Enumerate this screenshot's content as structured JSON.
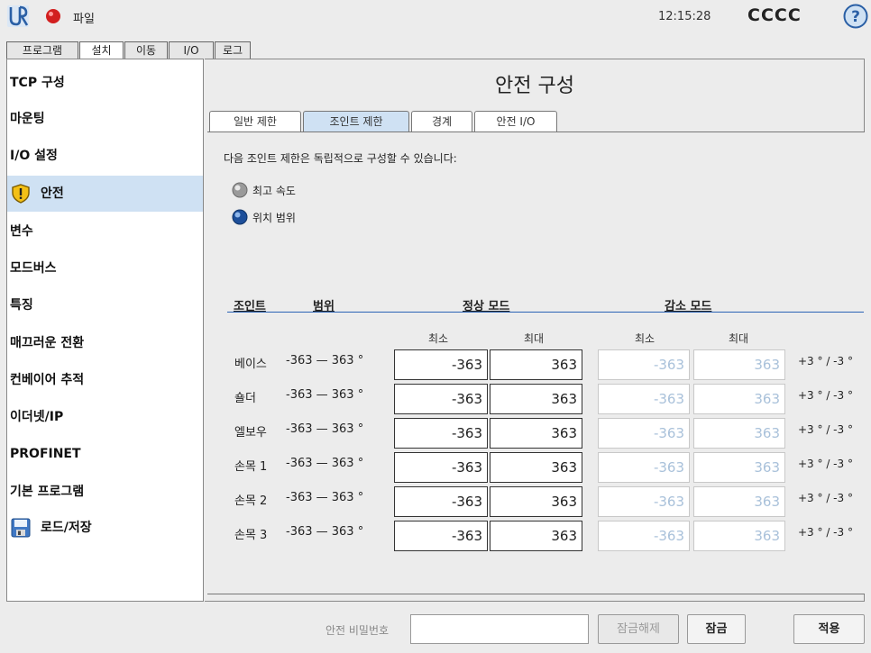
{
  "topbar": {
    "file_menu": "파일",
    "clock": "12:15:28",
    "robot_name": "CCCC"
  },
  "main_tabs": [
    "프로그램",
    "설치",
    "이동",
    "I/O",
    "로그"
  ],
  "sidebar": {
    "items": [
      "TCP 구성",
      "마운팅",
      "I/O 설정",
      "안전",
      "변수",
      "모드버스",
      "특징",
      "매끄러운 전환",
      "컨베이어 추적",
      "이더넷/IP",
      "PROFINET",
      "기본 프로그램",
      "로드/저장"
    ]
  },
  "panel": {
    "title": "안전 구성",
    "sub_tabs": [
      "일반 제한",
      "조인트 제한",
      "경계",
      "안전 I/O"
    ],
    "description": "다음 조인트 제한은 독립적으로 구성할 수 있습니다:",
    "radios": [
      "최고 속도",
      "위치 범위"
    ],
    "headers": {
      "joint": "조인트",
      "range": "범위",
      "normal_mode": "정상 모드",
      "reduced_mode": "감소 모드",
      "min": "최소",
      "max": "최대"
    },
    "rows": [
      {
        "name": "베이스",
        "range": "-363 — 363 °",
        "normal_min": "-363",
        "normal_max": "363",
        "reduced_min": "-363",
        "reduced_max": "363",
        "tolerance": "+3 ° / -3 °"
      },
      {
        "name": "숄더",
        "range": "-363 — 363 °",
        "normal_min": "-363",
        "normal_max": "363",
        "reduced_min": "-363",
        "reduced_max": "363",
        "tolerance": "+3 ° / -3 °"
      },
      {
        "name": "엘보우",
        "range": "-363 — 363 °",
        "normal_min": "-363",
        "normal_max": "363",
        "reduced_min": "-363",
        "reduced_max": "363",
        "tolerance": "+3 ° / -3 °"
      },
      {
        "name": "손목 1",
        "range": "-363 — 363 °",
        "normal_min": "-363",
        "normal_max": "363",
        "reduced_min": "-363",
        "reduced_max": "363",
        "tolerance": "+3 ° / -3 °"
      },
      {
        "name": "손목 2",
        "range": "-363 — 363 °",
        "normal_min": "-363",
        "normal_max": "363",
        "reduced_min": "-363",
        "reduced_max": "363",
        "tolerance": "+3 ° / -3 °"
      },
      {
        "name": "손목 3",
        "range": "-363 — 363 °",
        "normal_min": "-363",
        "normal_max": "363",
        "reduced_min": "-363",
        "reduced_max": "363",
        "tolerance": "+3 ° / -3 °"
      }
    ]
  },
  "bottom": {
    "password_label": "안전 비밀번호",
    "password_value": "",
    "unlock_label": "잠금해제",
    "lock_label": "잠금",
    "apply_label": "적용"
  },
  "colors": {
    "selection": "#cfe1f3",
    "rule": "#2b64b6",
    "warning": "#f3c016",
    "stop": "#d21f1f"
  }
}
